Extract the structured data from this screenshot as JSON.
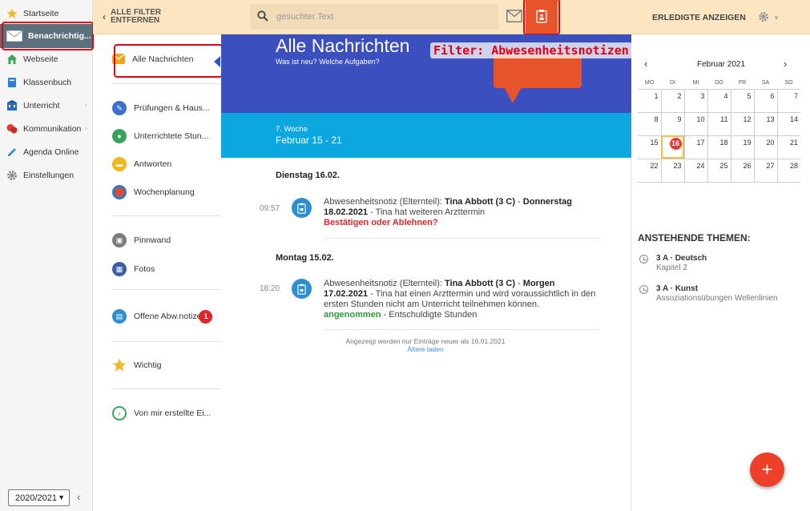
{
  "nav": {
    "items": [
      {
        "label": "Startseite"
      },
      {
        "label": "Benachrichtig..."
      },
      {
        "label": "Webseite"
      },
      {
        "label": "Klassenbuch"
      },
      {
        "label": "Unterricht"
      },
      {
        "label": "Kommunikation"
      },
      {
        "label": "Agenda Online"
      },
      {
        "label": "Einstellungen"
      }
    ],
    "year": "2020/2021"
  },
  "topbar": {
    "clear_filter_line1": "ALLE FILTER",
    "clear_filter_line2": "ENTFERNEN",
    "search_placeholder": "gesuchter Text",
    "show_done": "ERLEDIGTE ANZEIGEN"
  },
  "annotation": {
    "filter_caption": "Filter: Abwesenheitsnotizen"
  },
  "subnav": {
    "items": [
      {
        "label": "Alle Nachrichten"
      },
      {
        "label": "Prüfungen & Haus..."
      },
      {
        "label": "Unterrichtete Stun..."
      },
      {
        "label": "Antworten"
      },
      {
        "label": "Wochenplanung"
      },
      {
        "label": "Pinnwand"
      },
      {
        "label": "Fotos"
      },
      {
        "label": "Offene Abw.notize",
        "badge": "1"
      },
      {
        "label": "Wichtig"
      },
      {
        "label": "Von mir erstellte Ei..."
      }
    ]
  },
  "main": {
    "title": "Alle Nachrichten",
    "subtitle": "Was ist neu? Welche Aufgaben?",
    "week_label": "7. Woche",
    "week_dates": "Februar 15 - 21",
    "days": [
      {
        "heading": "Dienstag 16.02.",
        "time": "09:57",
        "prefix": "Abwesenheitsnotiz (Elternteil): ",
        "who": "Tina Abbott (3 C)",
        "dash": " - ",
        "when": "Donnerstag 18.02.2021",
        "text": " - Tina hat weiteren Arzttermin",
        "action": "Bestätigen oder Ablehnen?"
      },
      {
        "heading": "Montag 15.02.",
        "time": "18:20",
        "prefix": "Abwesenheitsnotiz (Elternteil): ",
        "who": "Tina Abbott (3 C)",
        "dash": " - ",
        "when": "Morgen 17.02.2021",
        "text": " - Tina hat einen Arzttermin und wird voraussichtlich in den ersten Stunden nicht am Unterricht teilnehmen können.",
        "status": "angenommen",
        "status_suffix": " - Entschuldigte Stunden"
      }
    ],
    "footnote": "Angezeigt werden nur Einträge neuer als 16.01.2021",
    "older_link": "Ältere laden"
  },
  "calendar": {
    "month": "Februar 2021",
    "weekdays": [
      "MO",
      "DI",
      "MI",
      "DO",
      "FR",
      "SA",
      "SO"
    ],
    "weeks": [
      [
        "1",
        "2",
        "3",
        "4",
        "5",
        "6",
        "7"
      ],
      [
        "8",
        "9",
        "10",
        "11",
        "12",
        "13",
        "14"
      ],
      [
        "15",
        "16",
        "17",
        "18",
        "19",
        "20",
        "21"
      ],
      [
        "22",
        "23",
        "24",
        "25",
        "26",
        "27",
        "28"
      ]
    ],
    "today": "16",
    "selected": "16"
  },
  "topics": {
    "title": "ANSTEHENDE THEMEN:",
    "items": [
      {
        "title": "3 A · Deutsch",
        "detail": "Kapitel 2"
      },
      {
        "title": "3 A · Kunst",
        "detail": "Assoziationsübungen Wellenlinien"
      }
    ]
  },
  "fab": {
    "label": "+"
  },
  "colors": {
    "accent_orange": "#e8542a",
    "hero_blue": "#3b4fbe",
    "week_blue": "#0da7df",
    "annotation_red": "#e3000f"
  }
}
